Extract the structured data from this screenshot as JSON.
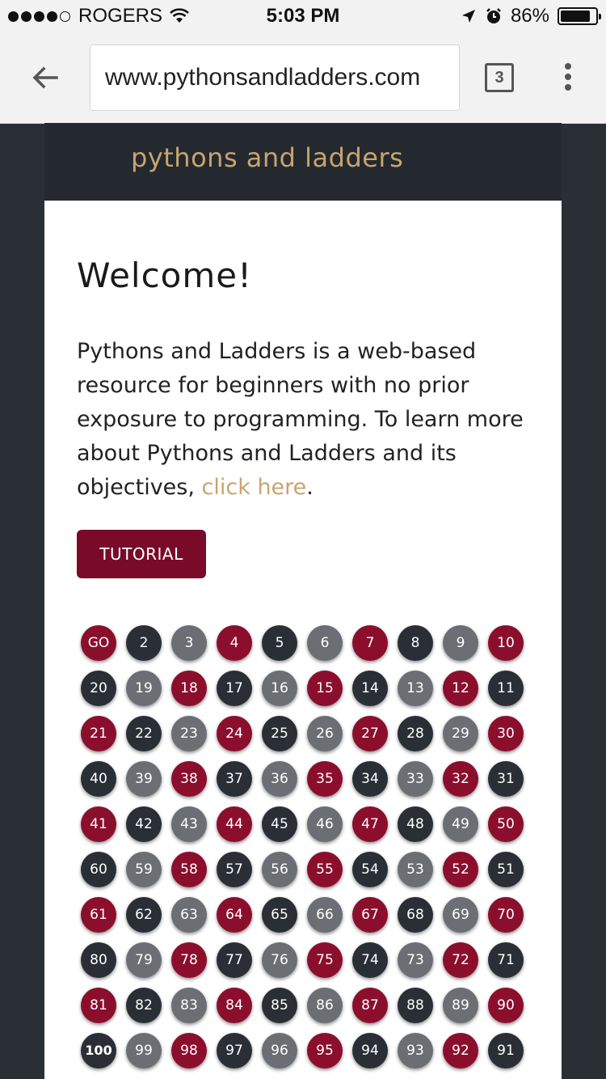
{
  "status_bar": {
    "carrier": "ROGERS",
    "time": "5:03 PM",
    "battery": "86%",
    "battery_level": 0.86,
    "signal_bars": 4
  },
  "browser": {
    "url": "www.pythonsandladders.com",
    "tab_count": "3"
  },
  "site": {
    "brand": "pythons and ladders",
    "welcome": "Welcome!",
    "intro_text": "Pythons and Ladders is a web-based resource for beginners with no prior exposure to programming. To learn more about Pythons and Ladders and its objectives, ",
    "intro_link": "click here",
    "intro_end": ".",
    "tutorial_button": "TUTORIAL"
  },
  "colors": {
    "red": "#8b0f2c",
    "dark": "#2a2f35",
    "gray": "#6b6f73",
    "accent": "#c9a46e"
  },
  "board": {
    "rows": [
      [
        "GO",
        "2",
        "3",
        "4",
        "5",
        "6",
        "7",
        "8",
        "9",
        "10"
      ],
      [
        "20",
        "19",
        "18",
        "17",
        "16",
        "15",
        "14",
        "13",
        "12",
        "11"
      ],
      [
        "21",
        "22",
        "23",
        "24",
        "25",
        "26",
        "27",
        "28",
        "29",
        "30"
      ],
      [
        "40",
        "39",
        "38",
        "37",
        "36",
        "35",
        "34",
        "33",
        "32",
        "31"
      ],
      [
        "41",
        "42",
        "43",
        "44",
        "45",
        "46",
        "47",
        "48",
        "49",
        "50"
      ],
      [
        "60",
        "59",
        "58",
        "57",
        "56",
        "55",
        "54",
        "53",
        "52",
        "51"
      ],
      [
        "61",
        "62",
        "63",
        "64",
        "65",
        "66",
        "67",
        "68",
        "69",
        "70"
      ],
      [
        "80",
        "79",
        "78",
        "77",
        "76",
        "75",
        "74",
        "73",
        "72",
        "71"
      ],
      [
        "81",
        "82",
        "83",
        "84",
        "85",
        "86",
        "87",
        "88",
        "89",
        "90"
      ],
      [
        "100",
        "99",
        "98",
        "97",
        "96",
        "95",
        "94",
        "93",
        "92",
        "91"
      ]
    ],
    "color_pattern_even_rows": [
      "red",
      "dark",
      "gray",
      "red",
      "dark",
      "gray",
      "red",
      "dark",
      "gray",
      "red"
    ],
    "color_pattern_odd_rows": [
      "dark",
      "gray",
      "red",
      "dark",
      "gray",
      "red",
      "dark",
      "gray",
      "red",
      "dark"
    ]
  }
}
